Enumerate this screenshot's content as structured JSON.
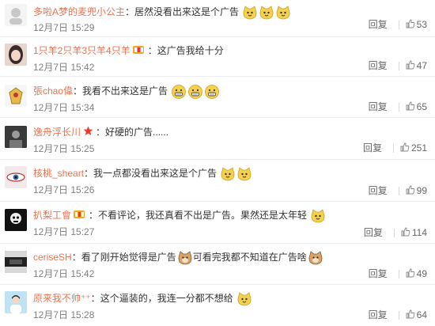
{
  "comments": [
    {
      "user": "多啦A梦的麦兜小公主",
      "badge": "",
      "text": "居然没看出来这是个广告",
      "emoji": [
        "yellow-cat",
        "yellow-cat",
        "yellow-cat"
      ],
      "time": "12月7日 15:29",
      "reply": "回复",
      "likes": "53"
    },
    {
      "user": "1只羊2只羊3只羊4只羊",
      "badge": "vip",
      "text": "这广告我给十分",
      "emoji": [],
      "time": "12月7日 15:42",
      "reply": "回复",
      "likes": "47"
    },
    {
      "user": "張chao偉",
      "badge": "",
      "text": "我看不出来这是广告",
      "emoji": [
        "grin-face",
        "grin-face",
        "grin-face"
      ],
      "time": "12月7日 15:34",
      "reply": "回复",
      "likes": "65"
    },
    {
      "user": "逸舟浮长川",
      "badge": "star",
      "text": "好硬的广告......",
      "emoji": [],
      "time": "12月7日 15:25",
      "reply": "回复",
      "likes": "251"
    },
    {
      "user": "核桃_sheart",
      "badge": "",
      "text": "我一点都没看出来这是个广告",
      "emoji": [
        "yellow-cat",
        "yellow-cat"
      ],
      "time": "12月7日 15:26",
      "reply": "回复",
      "likes": "99"
    },
    {
      "user": "扒梨工會",
      "badge": "vip",
      "text": "不看评论，我还真看不出是广告。果然还是太年轻",
      "emoji": [
        "yellow-cat"
      ],
      "time": "12月7日 15:27",
      "reply": "回复",
      "likes": "114"
    },
    {
      "user": "ceriseSH",
      "badge": "",
      "text": "看了刚开始觉得是广告",
      "text2": "可看完我都不知道在广告啥",
      "emoji": [
        "brown-cat"
      ],
      "emoji2": [
        "brown-cat"
      ],
      "time": "12月7日 15:42",
      "reply": "回复",
      "likes": "49"
    },
    {
      "user": "原来我不帅⁺⁺",
      "badge": "",
      "text": "这个逼装的，我连一分都不想给",
      "emoji": [
        "yellow-cat"
      ],
      "time": "12月7日 15:28",
      "reply": "回复",
      "likes": "64"
    }
  ]
}
